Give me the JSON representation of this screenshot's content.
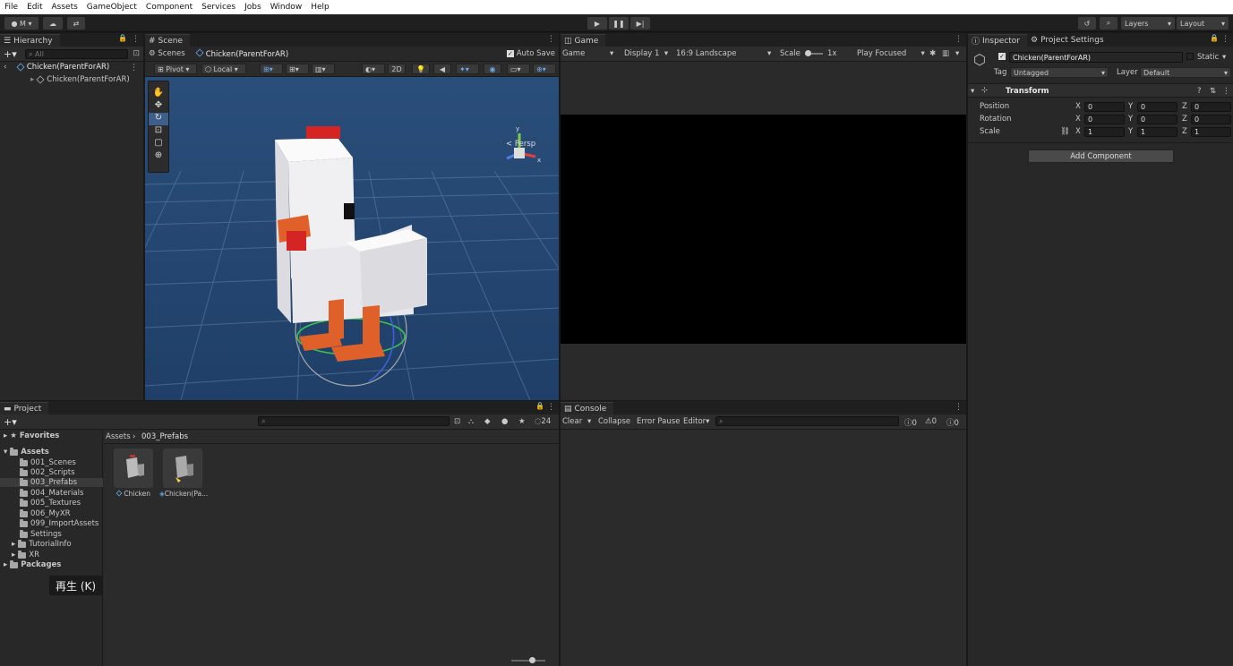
{
  "menu": [
    "File",
    "Edit",
    "Assets",
    "GameObject",
    "Component",
    "Services",
    "Jobs",
    "Window",
    "Help"
  ],
  "toolbar": {
    "account": "M",
    "layers": "Layers",
    "layout": "Layout"
  },
  "hierarchy": {
    "tab": "Hierarchy",
    "search_placeholder": "All",
    "root": "Chicken(ParentForAR)",
    "child": "Chicken(ParentForAR)"
  },
  "scene": {
    "tab": "Scene",
    "breadcrumb_root": "Scenes",
    "breadcrumb_item": "Chicken(ParentForAR)",
    "auto_save": "Auto Save",
    "pivot": "Pivot",
    "local": "Local",
    "mode_2d": "2D",
    "persp": "Persp"
  },
  "game": {
    "tab": "Game",
    "game_dropdown": "Game",
    "display": "Display 1",
    "aspect": "16:9 Landscape",
    "scale_label": "Scale",
    "scale_value": "1x",
    "play_focused": "Play Focused"
  },
  "inspector": {
    "tab": "Inspector",
    "tab2": "Project Settings",
    "object_name": "Chicken(ParentForAR)",
    "static": "Static",
    "tag_label": "Tag",
    "tag_value": "Untagged",
    "layer_label": "Layer",
    "layer_value": "Default",
    "component": "Transform",
    "rows": [
      {
        "label": "Position",
        "x": "0",
        "y": "0",
        "z": "0"
      },
      {
        "label": "Rotation",
        "x": "0",
        "y": "0",
        "z": "0"
      },
      {
        "label": "Scale",
        "x": "1",
        "y": "1",
        "z": "1"
      }
    ],
    "axis_x": "X",
    "axis_y": "Y",
    "axis_z": "Z",
    "add_component": "Add Component"
  },
  "project": {
    "tab": "Project",
    "favorites": "Favorites",
    "assets": "Assets",
    "folders": [
      "001_Scenes",
      "002_Scripts",
      "003_Prefabs",
      "004_Materials",
      "005_Textures",
      "006_MyXR",
      "099_ImportAssets",
      "Settings",
      "TutorialInfo",
      "XR"
    ],
    "packages": "Packages",
    "breadcrumb_root": "Assets",
    "breadcrumb_item": "003_Prefabs",
    "count": "24",
    "items": [
      "Chicken",
      "Chicken(Pa..."
    ]
  },
  "console": {
    "tab": "Console",
    "clear": "Clear",
    "collapse": "Collapse",
    "error_pause": "Error Pause",
    "editor": "Editor",
    "count_log": "0",
    "count_warn": "0",
    "count_err": "0"
  },
  "tooltip": "再生 (K)"
}
